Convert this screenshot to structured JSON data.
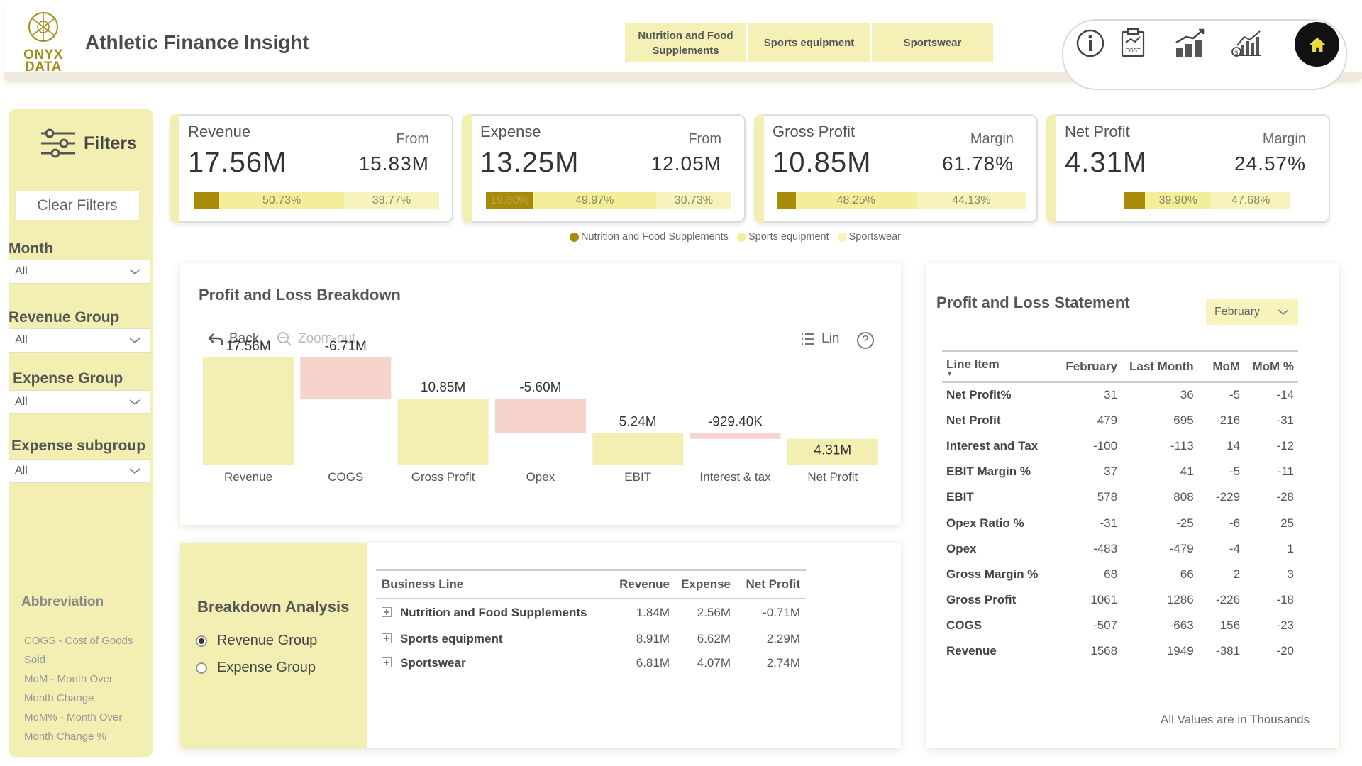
{
  "app": {
    "logo_text_1": "ONYX",
    "logo_text_2": "DATA",
    "title": "Athletic Finance Insight"
  },
  "segment_tabs": [
    {
      "label_1": "Nutrition and Food",
      "label_2": "Supplements"
    },
    {
      "label": "Sports equipment"
    },
    {
      "label": "Sportswear"
    }
  ],
  "nav_icons": [
    "info-icon",
    "cost-clipboard-icon",
    "coins-growth-chart-icon",
    "dollar-bar-chart-icon",
    "home-icon"
  ],
  "sidebar": {
    "filters_label": "Filters",
    "clear_filters": "Clear Filters",
    "slicers": [
      {
        "label": "Month",
        "value": "All"
      },
      {
        "label": "Revenue Group",
        "value": "All"
      },
      {
        "label": "Expense Group",
        "value": "All"
      },
      {
        "label": "Expense subgroup",
        "value": "All"
      }
    ],
    "abbreviation_title": "Abbreviation",
    "abbreviations": [
      "COGS - Cost of Goods",
      "Sold",
      "MoM - Month Over",
      "Month Change",
      "MoM% - Month Over",
      "Month Change %"
    ]
  },
  "kpis": [
    {
      "title": "Revenue",
      "value": "17.56M",
      "sub_label": "From",
      "sub_value": "15.83M",
      "segments": [
        {
          "label": "",
          "share": 10.5
        },
        {
          "label": "50.73%",
          "share": 50.73
        },
        {
          "label": "38.77%",
          "share": 38.77
        }
      ]
    },
    {
      "title": "Expense",
      "value": "13.25M",
      "sub_label": "From",
      "sub_value": "12.05M",
      "segments": [
        {
          "label": "19.30%",
          "share": 19.3
        },
        {
          "label": "49.97%",
          "share": 49.97
        },
        {
          "label": "30.73%",
          "share": 30.73
        }
      ]
    },
    {
      "title": "Gross Profit",
      "value": "10.85M",
      "sub_label": "Margin",
      "sub_value": "61.78%",
      "segments": [
        {
          "label": "",
          "share": 7.62
        },
        {
          "label": "48.25%",
          "share": 48.25
        },
        {
          "label": "44.13%",
          "share": 44.13
        }
      ]
    },
    {
      "title": "Net Profit",
      "value": "4.31M",
      "sub_label": "Margin",
      "sub_value": "24.57%",
      "segments": [
        {
          "label": "",
          "share": 12.42
        },
        {
          "label": "39.90%",
          "share": 39.9
        },
        {
          "label": "47.68%",
          "share": 47.68
        }
      ]
    }
  ],
  "kpi_legend": [
    {
      "label": "Nutrition and Food Supplements",
      "color": "#a88b08"
    },
    {
      "label": "Sports equipment",
      "color": "#f2ee9a"
    },
    {
      "label": "Sportswear",
      "color": "#f6f3bd"
    }
  ],
  "pl_breakdown": {
    "title": "Profit and Loss Breakdown",
    "back": "Back",
    "zoom_out": "Zoom-out",
    "lin": "Lin",
    "help": "?"
  },
  "chart_data": {
    "type": "bar",
    "subtype": "waterfall",
    "categories": [
      "Revenue",
      "COGS",
      "Gross Profit",
      "Opex",
      "EBIT",
      "Interest & tax",
      "Net Profit"
    ],
    "values_millions": [
      17.56,
      -6.71,
      10.85,
      -5.6,
      5.24,
      -0.9294,
      4.31
    ],
    "labels": [
      "17.56M",
      "-6.71M",
      "10.85M",
      "-5.60M",
      "5.24M",
      "-929.40K",
      "4.31M"
    ],
    "kinds": [
      "total",
      "decrease",
      "total",
      "decrease",
      "total",
      "decrease",
      "total"
    ],
    "colors": {
      "total": "#f3efb2",
      "decrease": "#f6d3cb"
    },
    "ylim": [
      0,
      17.56
    ]
  },
  "breakdown": {
    "title": "Breakdown Analysis",
    "options": [
      {
        "label": "Revenue Group",
        "selected": true
      },
      {
        "label": "Expense Group",
        "selected": false
      }
    ],
    "columns": [
      "Business Line",
      "Revenue",
      "Expense",
      "Net Profit"
    ],
    "rows": [
      [
        "Nutrition and Food Supplements",
        "1.84M",
        "2.56M",
        "-0.71M"
      ],
      [
        "Sports equipment",
        "8.91M",
        "6.62M",
        "2.29M"
      ],
      [
        "Sportswear",
        "6.81M",
        "4.07M",
        "2.74M"
      ]
    ]
  },
  "pls": {
    "title": "Profit and Loss Statement",
    "month": "February",
    "columns": [
      "Line Item",
      "February",
      "Last Month",
      "MoM",
      "MoM %"
    ],
    "rows": [
      [
        "Net Profit%",
        "31",
        "36",
        "-5",
        "-14"
      ],
      [
        "Net Profit",
        "479",
        "695",
        "-216",
        "-31"
      ],
      [
        "Interest and Tax",
        "-100",
        "-113",
        "14",
        "-12"
      ],
      [
        "EBIT Margin %",
        "37",
        "41",
        "-5",
        "-11"
      ],
      [
        "EBIT",
        "578",
        "808",
        "-229",
        "-28"
      ],
      [
        "Opex Ratio %",
        "-31",
        "-25",
        "-6",
        "25"
      ],
      [
        "Opex",
        "-483",
        "-479",
        "-4",
        "1"
      ],
      [
        "Gross Margin %",
        "68",
        "66",
        "2",
        "3"
      ],
      [
        "Gross Profit",
        "1061",
        "1286",
        "-226",
        "-18"
      ],
      [
        "COGS",
        "-507",
        "-663",
        "156",
        "-23"
      ],
      [
        "Revenue",
        "1568",
        "1949",
        "-381",
        "-20"
      ]
    ],
    "note": "All Values are in Thousands"
  }
}
